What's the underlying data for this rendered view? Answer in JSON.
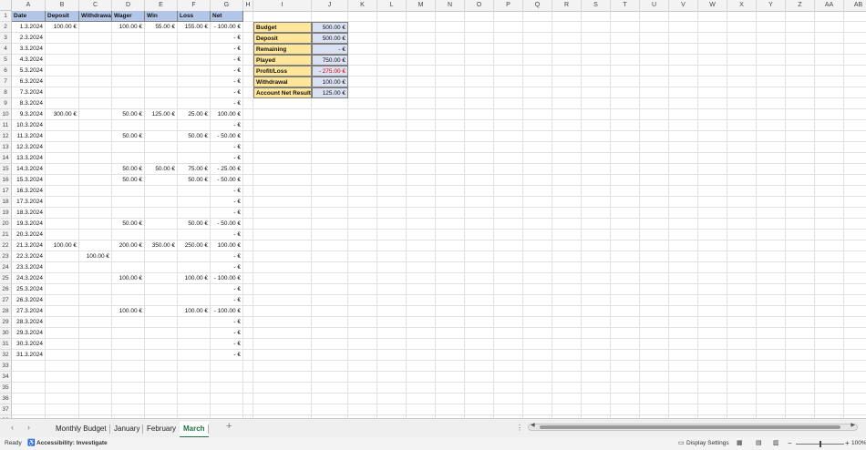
{
  "column_headers": [
    "A",
    "B",
    "C",
    "D",
    "E",
    "F",
    "G",
    "H",
    "I",
    "J",
    "K",
    "L",
    "M",
    "N",
    "O",
    "P",
    "Q",
    "R",
    "S",
    "T",
    "U",
    "V",
    "W",
    "X",
    "Y",
    "Z",
    "AA",
    "AB"
  ],
  "row_numbers": [
    "1",
    "2",
    "3",
    "4",
    "5",
    "6",
    "7",
    "8",
    "9",
    "10",
    "11",
    "12",
    "13",
    "14",
    "15",
    "16",
    "17",
    "18",
    "19",
    "20",
    "21",
    "22",
    "23",
    "24",
    "25",
    "26",
    "27",
    "28",
    "29",
    "30",
    "31",
    "32",
    "33",
    "34",
    "35",
    "36",
    "37",
    "38"
  ],
  "table": {
    "headers": [
      "Date",
      "Deposit",
      "Withdrawa",
      "Wager",
      "Win",
      "Loss",
      "Net"
    ],
    "rows": [
      [
        "1.3.2024",
        "100.00 €",
        "",
        "100.00 €",
        "55.00 €",
        "155.00 €",
        "-  100.00 €"
      ],
      [
        "2.3.2024",
        "",
        "",
        "",
        "",
        "",
        "-      €"
      ],
      [
        "3.3.2024",
        "",
        "",
        "",
        "",
        "",
        "-      €"
      ],
      [
        "4.3.2024",
        "",
        "",
        "",
        "",
        "",
        "-      €"
      ],
      [
        "5.3.2024",
        "",
        "",
        "",
        "",
        "",
        "-      €"
      ],
      [
        "6.3.2024",
        "",
        "",
        "",
        "",
        "",
        "-      €"
      ],
      [
        "7.3.2024",
        "",
        "",
        "",
        "",
        "",
        "-      €"
      ],
      [
        "8.3.2024",
        "",
        "",
        "",
        "",
        "",
        "-      €"
      ],
      [
        "9.3.2024",
        "300.00 €",
        "",
        "50.00 €",
        "125.00 €",
        "25.00 €",
        "100.00 €"
      ],
      [
        "10.3.2024",
        "",
        "",
        "",
        "",
        "",
        "-      €"
      ],
      [
        "11.3.2024",
        "",
        "",
        "50.00 €",
        "",
        "50.00 €",
        "-    50.00 €"
      ],
      [
        "12.3.2024",
        "",
        "",
        "",
        "",
        "",
        "-      €"
      ],
      [
        "13.3.2024",
        "",
        "",
        "",
        "",
        "",
        "-      €"
      ],
      [
        "14.3.2024",
        "",
        "",
        "50.00 €",
        "50.00 €",
        "75.00 €",
        "-    25.00 €"
      ],
      [
        "15.3.2024",
        "",
        "",
        "50.00 €",
        "",
        "50.00 €",
        "-    50.00 €"
      ],
      [
        "16.3.2024",
        "",
        "",
        "",
        "",
        "",
        "-      €"
      ],
      [
        "17.3.2024",
        "",
        "",
        "",
        "",
        "",
        "-      €"
      ],
      [
        "18.3.2024",
        "",
        "",
        "",
        "",
        "",
        "-      €"
      ],
      [
        "19.3.2024",
        "",
        "",
        "50.00 €",
        "",
        "50.00 €",
        "-    50.00 €"
      ],
      [
        "20.3.2024",
        "",
        "",
        "",
        "",
        "",
        "-      €"
      ],
      [
        "21.3.2024",
        "100.00 €",
        "",
        "200.00 €",
        "350.00 €",
        "250.00 €",
        "100.00 €"
      ],
      [
        "22.3.2024",
        "",
        "100.00 €",
        "",
        "",
        "",
        "-      €"
      ],
      [
        "23.3.2024",
        "",
        "",
        "",
        "",
        "",
        "-      €"
      ],
      [
        "24.3.2024",
        "",
        "",
        "100.00 €",
        "",
        "100.00 €",
        "-  100.00 €"
      ],
      [
        "25.3.2024",
        "",
        "",
        "",
        "",
        "",
        "-      €"
      ],
      [
        "26.3.2024",
        "",
        "",
        "",
        "",
        "",
        "-      €"
      ],
      [
        "27.3.2024",
        "",
        "",
        "100.00 €",
        "",
        "100.00 €",
        "-  100.00 €"
      ],
      [
        "28.3.2024",
        "",
        "",
        "",
        "",
        "",
        "-      €"
      ],
      [
        "29.3.2024",
        "",
        "",
        "",
        "",
        "",
        "-      €"
      ],
      [
        "30.3.2024",
        "",
        "",
        "",
        "",
        "",
        "-      €"
      ],
      [
        "31.3.2024",
        "",
        "",
        "",
        "",
        "",
        "-      €"
      ]
    ]
  },
  "summary": [
    {
      "label": "Budget",
      "value": "500.00 €",
      "negative": false
    },
    {
      "label": "Deposit",
      "value": "500.00 €",
      "negative": false
    },
    {
      "label": "Remaining",
      "value": "-      €",
      "negative": false
    },
    {
      "label": "Played",
      "value": "750.00 €",
      "negative": false
    },
    {
      "label": "Profit/Loss",
      "value": "-    275.00 €",
      "negative": true
    },
    {
      "label": "Withdrawal",
      "value": "100.00 €",
      "negative": false
    },
    {
      "label": "Account Net Result",
      "value": "125.00 €",
      "negative": false
    }
  ],
  "tabs": {
    "prev_icon": "‹",
    "next_icon": "›",
    "items": [
      "Monthly Budget",
      "January",
      "February",
      "March"
    ],
    "active": "March",
    "add_icon": "+"
  },
  "status": {
    "ready": "Ready",
    "accessibility": "Accessibility: Investigate",
    "display_settings": "Display Settings",
    "zoom": "100%",
    "zoom_fraction": 0.5
  },
  "colors": {
    "header_fill": "#b4c6e7",
    "summary_label_fill": "#ffe699",
    "summary_value_fill": "#d9e1f2",
    "negative": "#e00000",
    "active_tab": "#1e7145"
  }
}
